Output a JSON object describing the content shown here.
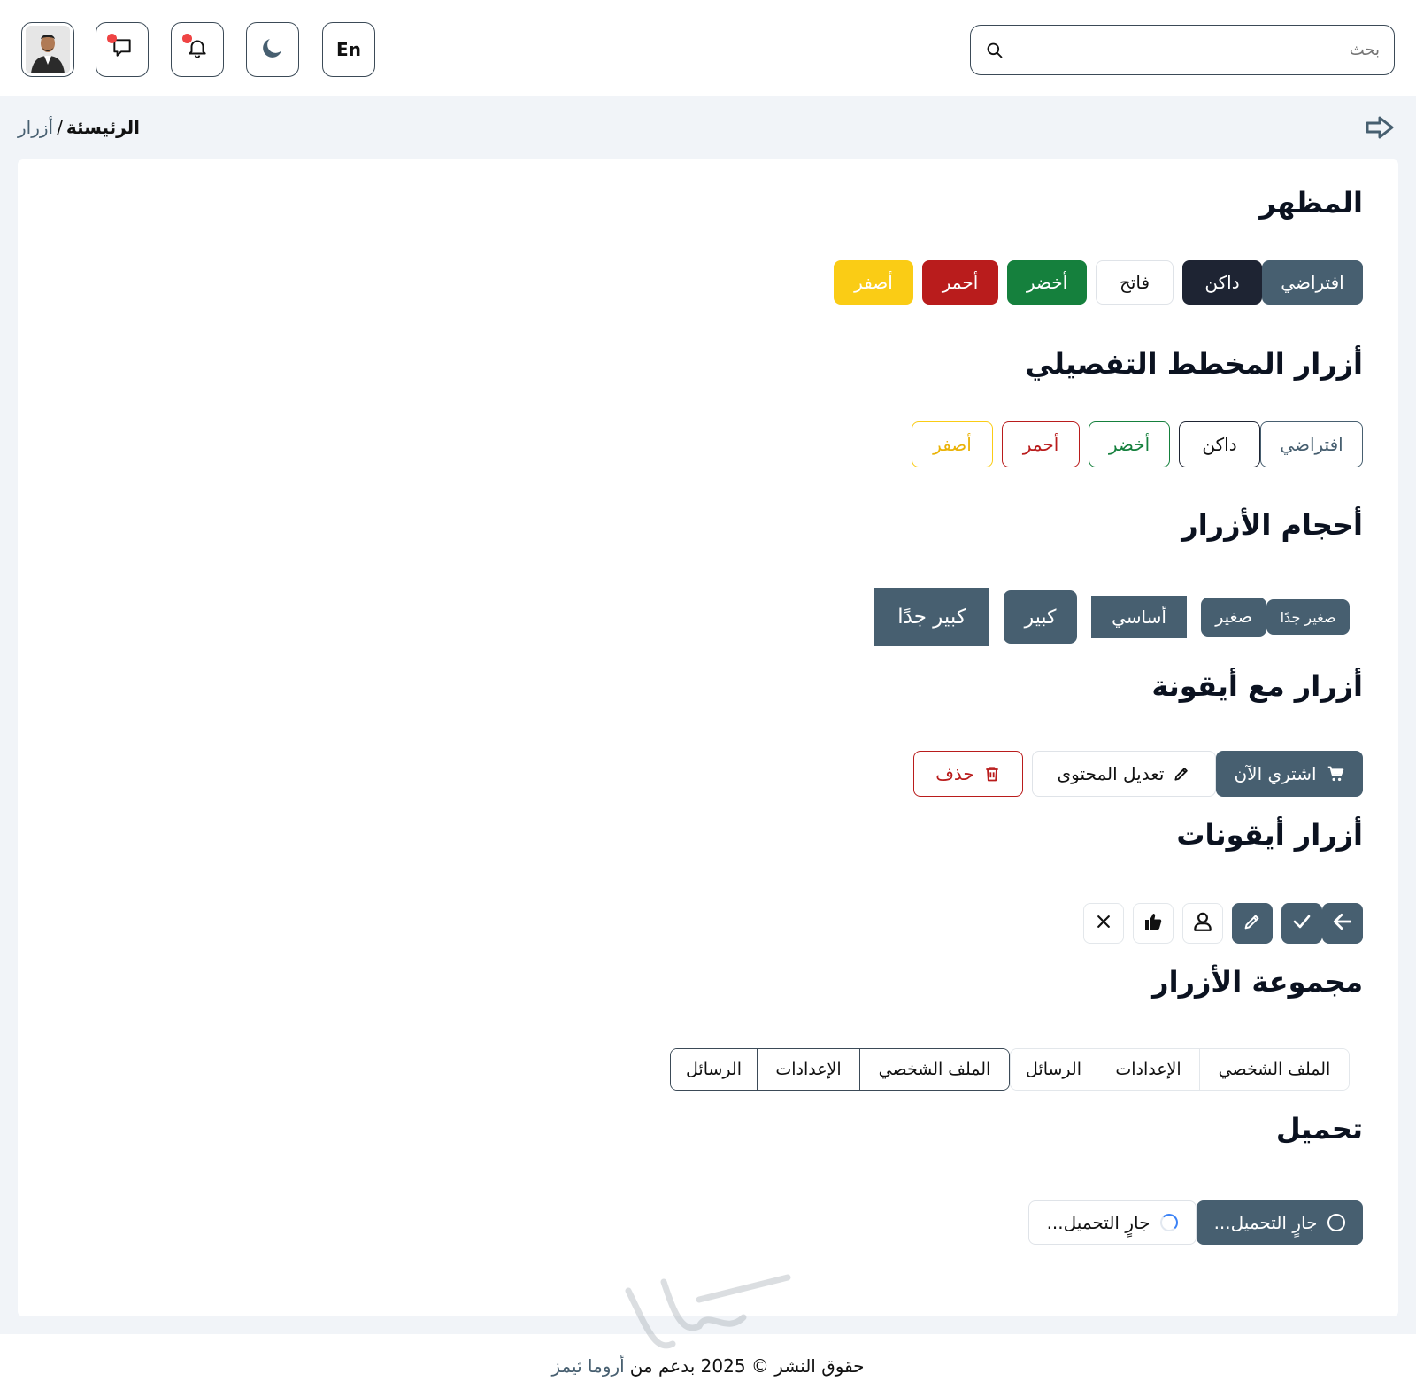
{
  "topbar": {
    "search_placeholder": "بحث",
    "lang_label": "En",
    "icons": [
      "search-icon",
      "moon-icon",
      "bell-icon",
      "chat-icon",
      "avatar"
    ]
  },
  "breadcrumb": {
    "home": "الرئيسئة",
    "separator": "/",
    "current": "أزرار"
  },
  "sections": {
    "appearance": {
      "title": "المظهر",
      "buttons": [
        "افتراضي",
        "داكن",
        "فاتح",
        "أخضر",
        "أحمر",
        "أصفر"
      ]
    },
    "outline": {
      "title": "أزرار المخطط التفصيلي",
      "buttons": [
        "افتراضي",
        "داكن",
        "أخضر",
        "أحمر",
        "أصفر"
      ]
    },
    "sizes": {
      "title": "أحجام الأزرار",
      "buttons": [
        "صغير جدًا",
        "صغير",
        "أساسي",
        "كبير",
        "كبير جدًا"
      ]
    },
    "with_icon": {
      "title": "أزرار مع أيقونة",
      "buttons": [
        "اشتري الآن",
        "تعديل المحتوى",
        "حذف"
      ]
    },
    "icon_buttons": {
      "title": "أزرار أيقونات",
      "icons": [
        "arrow-left-icon",
        "check-icon",
        "pencil-icon",
        "user-icon",
        "thumbs-up-icon",
        "close-icon"
      ]
    },
    "group": {
      "title": "مجموعة الأزرار",
      "items": [
        "الملف الشخصي",
        "الإعدادات",
        "الرسائل"
      ]
    },
    "loading": {
      "title": "تحميل",
      "buttons": [
        "جارٍ التحميل...",
        "جارٍ التحميل..."
      ]
    }
  },
  "colors": {
    "default": "#475f70",
    "dark": "#1e2433",
    "green": "#15803d",
    "red": "#b91c1c",
    "yellow": "#facc15"
  },
  "footer": {
    "text": "حقوق النشر © 2025 بدعم من",
    "link": "أروما ثيمز"
  }
}
